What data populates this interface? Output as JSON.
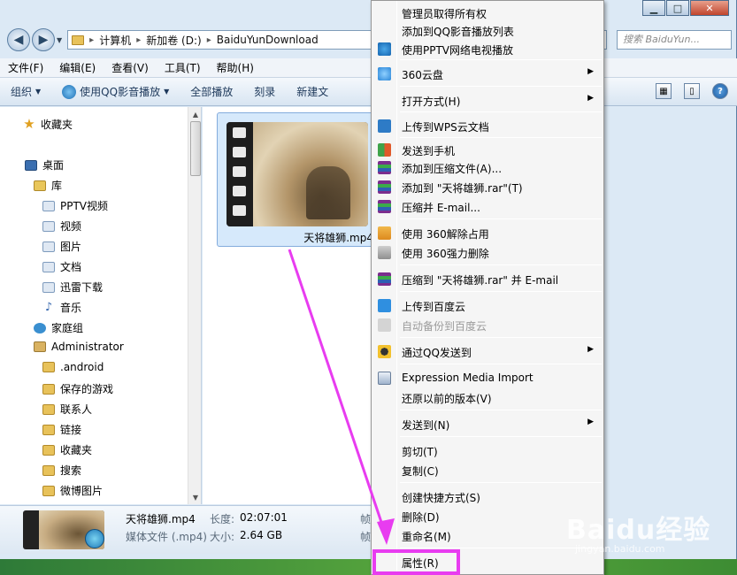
{
  "window": {
    "controls": {
      "minimize": "▁",
      "maximize": "□",
      "close": "✕"
    }
  },
  "address": {
    "path": [
      "计算机",
      "新加卷 (D:)",
      "BaiduYunDownload"
    ],
    "search_placeholder": "搜索 BaiduYun..."
  },
  "menubar": [
    "文件(F)",
    "编辑(E)",
    "查看(V)",
    "工具(T)",
    "帮助(H)"
  ],
  "toolbar": {
    "organize": "组织",
    "play_qq": "使用QQ影音播放",
    "play_all": "全部播放",
    "burn": "刻录",
    "new_folder": "新建文"
  },
  "navpane": {
    "favorites": "收藏夹",
    "desktop": "桌面",
    "library": "库",
    "lib_items": [
      "PPTV视频",
      "视频",
      "图片",
      "文档",
      "迅雷下载",
      "音乐"
    ],
    "homegroup": "家庭组",
    "admin": "Administrator",
    "admin_items": [
      ".android",
      "保存的游戏",
      "联系人",
      "链接",
      "收藏夹",
      "搜索",
      "微博图片"
    ]
  },
  "content": {
    "file_name": "天将雄狮.mp4"
  },
  "details": {
    "name": "天将雄狮.mp4",
    "type": "媒体文件 (.mp4)",
    "length_label": "长度:",
    "length": "02:07:01",
    "size_label": "大小:",
    "size": "2.64 GB",
    "frame_label_1": "帧",
    "frame_label_2": "帧"
  },
  "context_menu": {
    "items": [
      {
        "label": "管理员取得所有权"
      },
      {
        "label": "添加到QQ影音播放列表"
      },
      {
        "label": "使用PPTV网络电视播放",
        "icon": "pptv-icon"
      },
      {
        "label": "360云盘",
        "icon": "360-cloud-icon",
        "submenu": true
      },
      {
        "label": "打开方式(H)",
        "submenu": true
      },
      {
        "label": "上传到WPS云文档",
        "icon": "wps-icon"
      },
      {
        "label": "发送到手机",
        "icon": "phone-icon"
      },
      {
        "label": "添加到压缩文件(A)...",
        "icon": "winrar-icon"
      },
      {
        "label": "添加到 \"天将雄狮.rar\"(T)",
        "icon": "winrar-icon"
      },
      {
        "label": "压缩并 E-mail...",
        "icon": "winrar-icon"
      },
      {
        "label": "使用 360解除占用",
        "icon": "unlock-icon"
      },
      {
        "label": "使用 360强力删除",
        "icon": "shred-icon"
      },
      {
        "label": "压缩到 \"天将雄狮.rar\" 并 E-mail",
        "icon": "winrar-icon"
      },
      {
        "label": "上传到百度云",
        "icon": "baidu-cloud-icon"
      },
      {
        "label": "自动备份到百度云",
        "icon": "baidu-cloud-icon",
        "disabled": true
      },
      {
        "label": "通过QQ发送到",
        "icon": "qq-icon",
        "submenu": true
      },
      {
        "label": "Expression Media Import",
        "icon": "expression-icon"
      },
      {
        "label": "还原以前的版本(V)"
      },
      {
        "label": "发送到(N)",
        "submenu": true
      },
      {
        "label": "剪切(T)"
      },
      {
        "label": "复制(C)"
      },
      {
        "label": "创建快捷方式(S)"
      },
      {
        "label": "删除(D)"
      },
      {
        "label": "重命名(M)"
      },
      {
        "label": "属性(R)"
      }
    ]
  },
  "watermark": {
    "text": "Baidu经验",
    "sub": "jingyan.baidu.com"
  },
  "colors": {
    "highlight": "#e83cf0",
    "selection": "#d6e9fb"
  }
}
